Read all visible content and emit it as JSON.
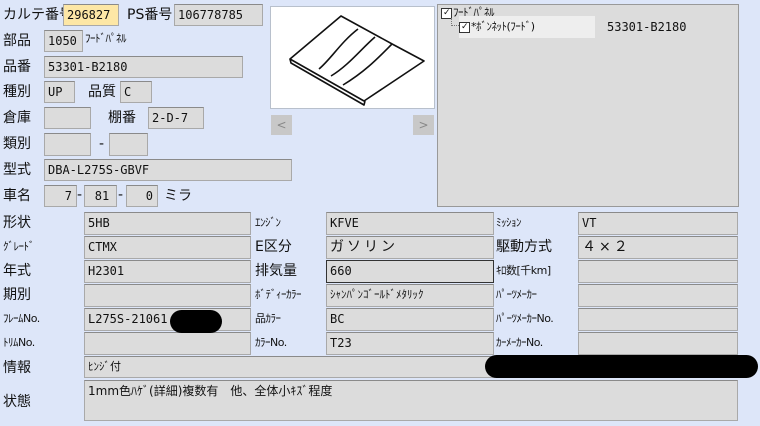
{
  "header": {
    "karte_label": "カルテ番号",
    "karte_no": "296827",
    "ps_label": "PS番号",
    "ps_no": "106778785"
  },
  "part": {
    "label": "部品",
    "code": "1050",
    "name": "ﾌｰﾄﾞﾊﾟﾈﾙ"
  },
  "part_no": {
    "label": "品番",
    "value": "53301-B2180"
  },
  "kind": {
    "label": "種別",
    "value": "UP",
    "quality_label": "品質",
    "quality": "C"
  },
  "warehouse": {
    "label": "倉庫",
    "value": "",
    "shelf_label": "棚番",
    "shelf": "2-D-7"
  },
  "category": {
    "label": "類別",
    "value1": "",
    "sep": "-",
    "value2": ""
  },
  "model": {
    "label": "型式",
    "value": "DBA-L275S-GBVF"
  },
  "car": {
    "label": "車名",
    "v1": "7",
    "v2": "81",
    "v3": "0",
    "sep": "-",
    "name": "ミラ"
  },
  "image_nav": {
    "prev": "<",
    "next": ">"
  },
  "tree": {
    "root": "ﾌｰﾄﾞﾊﾟﾈﾙ",
    "child": "*ﾎﾞﾝﾈｯﾄ(ﾌｰﾄﾞ)",
    "child_no": "53301-B2180"
  },
  "grid": [
    [
      {
        "label": "形状",
        "value": "5HB"
      },
      {
        "label": "ｴﾝｼﾞﾝ",
        "value": "KFVE"
      },
      {
        "label": "ﾐｯｼｮﾝ",
        "value": "VT"
      }
    ],
    [
      {
        "label": "ｸﾞﾚｰﾄﾞ",
        "value": "CTMX"
      },
      {
        "label": "E区分",
        "value": "ガソリン"
      },
      {
        "label": "駆動方式",
        "value": "４×２"
      }
    ],
    [
      {
        "label": "年式",
        "value": "H2301"
      },
      {
        "label": "排気量",
        "value": "660"
      },
      {
        "label": "ｷﾛ数[千km]",
        "value": ""
      }
    ],
    [
      {
        "label": "期別",
        "value": ""
      },
      {
        "label": "ﾎﾞﾃﾞｨｰｶﾗｰ",
        "value": "ｼｬﾝﾊﾟﾝｺﾞｰﾙﾄﾞﾒﾀﾘｯｸ"
      },
      {
        "label": "ﾊﾟｰﾂﾒｰｶｰ",
        "value": ""
      }
    ],
    [
      {
        "label": "ﾌﾚｰﾑNo.",
        "value": "L275S-21061"
      },
      {
        "label": "品ｶﾗｰ",
        "value": "BC"
      },
      {
        "label": "ﾊﾟｰﾂﾒｰｶｰNo.",
        "value": ""
      }
    ],
    [
      {
        "label": "ﾄﾘﾑNo.",
        "value": ""
      },
      {
        "label": "ｶﾗｰNo.",
        "value": "T23"
      },
      {
        "label": "ｶｰﾒｰｶｰNo.",
        "value": ""
      }
    ]
  ],
  "info": {
    "label": "情報",
    "value": "ﾋﾝｼﾞ付"
  },
  "state": {
    "label": "状態",
    "value": "1mm色ﾊｹﾞ(詳細)複数有　他、全体小ｷｽﾞ程度"
  }
}
